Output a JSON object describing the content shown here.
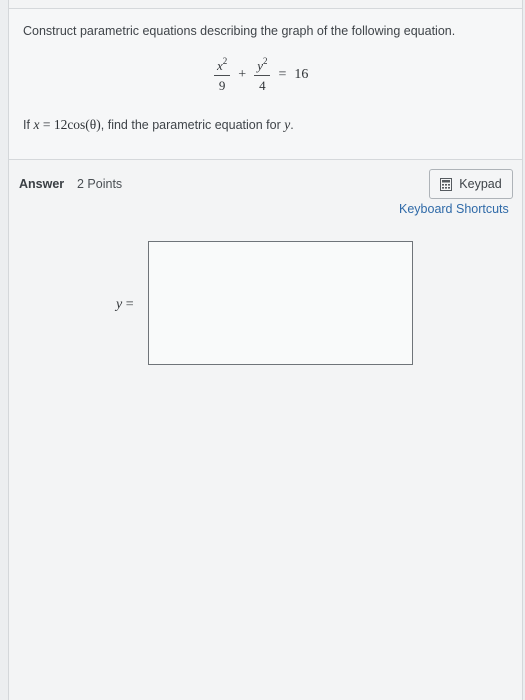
{
  "question": {
    "prompt": "Construct parametric equations describing the graph of the following equation.",
    "equation": {
      "term1_num_var": "x",
      "term1_num_exp": "2",
      "term1_den": "9",
      "plus": "+",
      "term2_num_var": "y",
      "term2_num_exp": "2",
      "term2_den": "4",
      "equals": "=",
      "rhs": "16"
    },
    "given": {
      "prefix": "If",
      "var": "x",
      "equals": "=",
      "expression": "12cos(θ)",
      "suffix": ", find the parametric equation for",
      "target_var": "y",
      "end": "."
    }
  },
  "answer": {
    "label": "Answer",
    "points": "2 Points",
    "keypad_label": "Keypad",
    "keypad_icon": "keypad-icon",
    "shortcuts_label": "Keyboard Shortcuts",
    "input_var": "y",
    "input_equals": "=",
    "input_value": ""
  },
  "colors": {
    "link": "#2f6aa8",
    "background": "#eceef0",
    "input_border": "#6f7479"
  }
}
